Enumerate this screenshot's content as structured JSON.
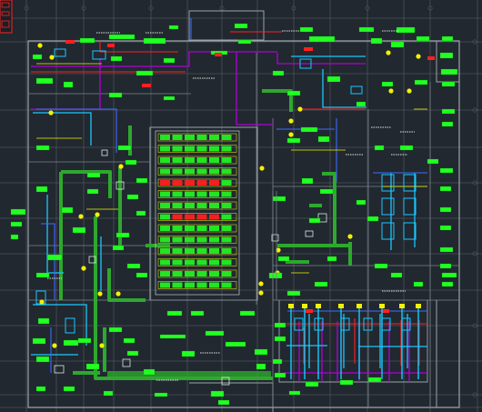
{
  "drawing": {
    "background": "#212830",
    "colors": {
      "grid": "#5c646d",
      "wall": "#9ca4aa",
      "thin": "#79818a",
      "green_label": "#22ff22",
      "yellow": "#f2f200",
      "cyan": "#19c7ff",
      "blue": "#3f6bff",
      "magenta": "#b000d8",
      "red": "#ff2020",
      "duct_green": "#2ea82e",
      "white": "#dfe7dd"
    }
  }
}
